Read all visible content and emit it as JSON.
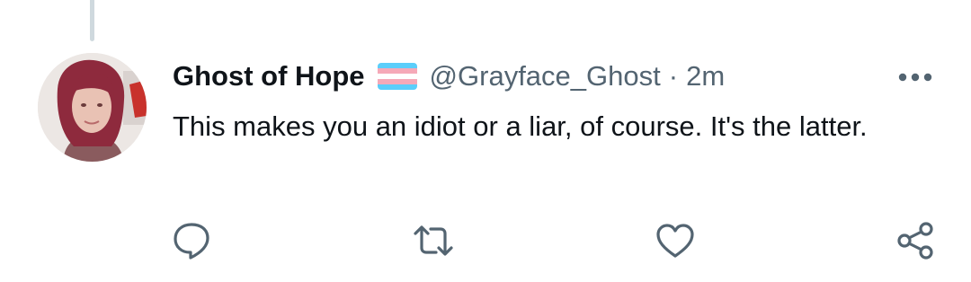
{
  "tweet": {
    "display_name": "Ghost of Hope",
    "handle": "@Grayface_Ghost",
    "separator": "·",
    "time": "2m",
    "text": "This makes you an idiot or a liar, of course. It's the latter.",
    "flag_emoji": "transgender-flag",
    "flag_colors": [
      "#5BCEFA",
      "#F5A9B8",
      "#FFFFFF",
      "#F5A9B8",
      "#5BCEFA"
    ]
  },
  "actions": [
    {
      "name": "reply",
      "icon": "speech-bubble-icon"
    },
    {
      "name": "retweet",
      "icon": "retweet-icon"
    },
    {
      "name": "like",
      "icon": "heart-icon"
    },
    {
      "name": "share",
      "icon": "share-icon"
    }
  ],
  "colors": {
    "text": "#0f1419",
    "secondary": "#536471",
    "icon": "#536471",
    "thread_line": "#cfd9de"
  }
}
